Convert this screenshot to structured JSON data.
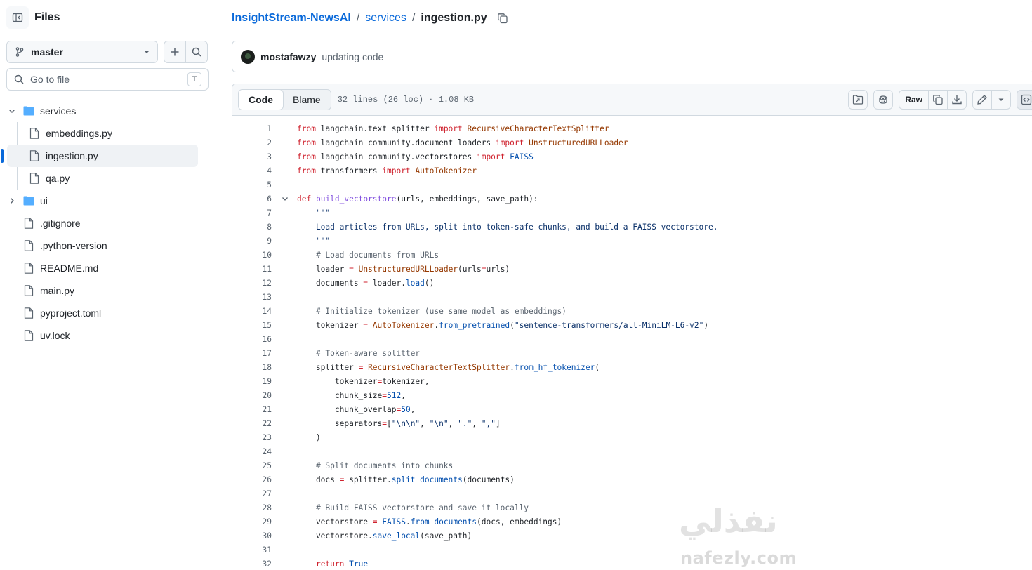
{
  "sidebar": {
    "title": "Files",
    "branch": "master",
    "go_to_file_placeholder": "Go to file",
    "shortcut_key": "T",
    "tree": [
      {
        "label": "services",
        "type": "folder",
        "expanded": true
      },
      {
        "label": "embeddings.py",
        "type": "file"
      },
      {
        "label": "ingestion.py",
        "type": "file",
        "selected": true
      },
      {
        "label": "qa.py",
        "type": "file"
      },
      {
        "label": "ui",
        "type": "folder",
        "expanded": false
      },
      {
        "label": ".gitignore",
        "type": "file"
      },
      {
        "label": ".python-version",
        "type": "file"
      },
      {
        "label": "README.md",
        "type": "file"
      },
      {
        "label": "main.py",
        "type": "file"
      },
      {
        "label": "pyproject.toml",
        "type": "file"
      },
      {
        "label": "uv.lock",
        "type": "file"
      }
    ]
  },
  "breadcrumb": {
    "repo": "InsightStream-NewsAI",
    "folder": "services",
    "separator": "/",
    "file": "ingestion.py"
  },
  "commit": {
    "author": "mostafawzy",
    "message": "updating code"
  },
  "file_header": {
    "tabs": [
      "Code",
      "Blame"
    ],
    "active_tab": "Code",
    "meta": "32 lines (26 loc) · 1.08 KB",
    "raw_label": "Raw"
  },
  "code_lines": [
    "from langchain.text_splitter import RecursiveCharacterTextSplitter",
    "from langchain_community.document_loaders import UnstructuredURLLoader",
    "from langchain_community.vectorstores import FAISS",
    "from transformers import AutoTokenizer",
    "",
    "def build_vectorstore(urls, embeddings, save_path):",
    "    \"\"\"",
    "    Load articles from URLs, split into token-safe chunks, and build a FAISS vectorstore.",
    "    \"\"\"",
    "    # Load documents from URLs",
    "    loader = UnstructuredURLLoader(urls=urls)",
    "    documents = loader.load()",
    "",
    "    # Initialize tokenizer (use same model as embeddings)",
    "    tokenizer = AutoTokenizer.from_pretrained(\"sentence-transformers/all-MiniLM-L6-v2\")",
    "",
    "    # Token-aware splitter",
    "    splitter = RecursiveCharacterTextSplitter.from_hf_tokenizer(",
    "        tokenizer=tokenizer,",
    "        chunk_size=512,",
    "        chunk_overlap=50,",
    "        separators=[\"\\n\\n\", \"\\n\", \".\", \",\"]",
    "    )",
    "",
    "    # Split documents into chunks",
    "    docs = splitter.split_documents(documents)",
    "",
    "    # Build FAISS vectorstore and save it locally",
    "    vectorstore = FAISS.from_documents(docs, embeddings)",
    "    vectorstore.save_local(save_path)",
    "",
    "    return True"
  ],
  "watermark": {
    "arabic": "نفذلي",
    "latin": "nafezly.com"
  },
  "colors": {
    "link": "#0969da",
    "keyword": "#cf222e",
    "string": "#0a3069",
    "comment": "#59636e",
    "folder": "#54aeff"
  }
}
